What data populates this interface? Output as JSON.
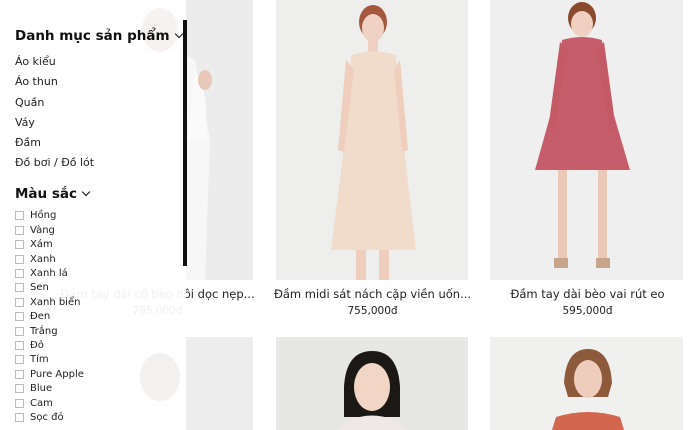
{
  "products": [
    {
      "name": "Đầm tay dài cổ bèo hôi dọc nẹp...",
      "price": "795,000đ"
    },
    {
      "name": "Đầm midi sát nách cặp viền uốn...",
      "price": "755,000đ"
    },
    {
      "name": "Đầm tay dài bèo vai rút eo",
      "price": "595,000đ"
    }
  ],
  "sidebar": {
    "category_title": "Danh mục sản phẩm",
    "categories": [
      "Áo kiểu",
      "Áo thun",
      "Quần",
      "Váy",
      "Đầm",
      "Đồ bơi / Đồ lót"
    ],
    "color_title": "Màu sắc",
    "colors": [
      "Hồng",
      "Vàng",
      "Xám",
      "Xanh",
      "Xanh lá",
      "Sen",
      "Xanh biển",
      "Đen",
      "Trắng",
      "Đỏ",
      "Tím",
      "Pure Apple",
      "Blue",
      "Cam",
      "Sọc đỏ"
    ]
  }
}
